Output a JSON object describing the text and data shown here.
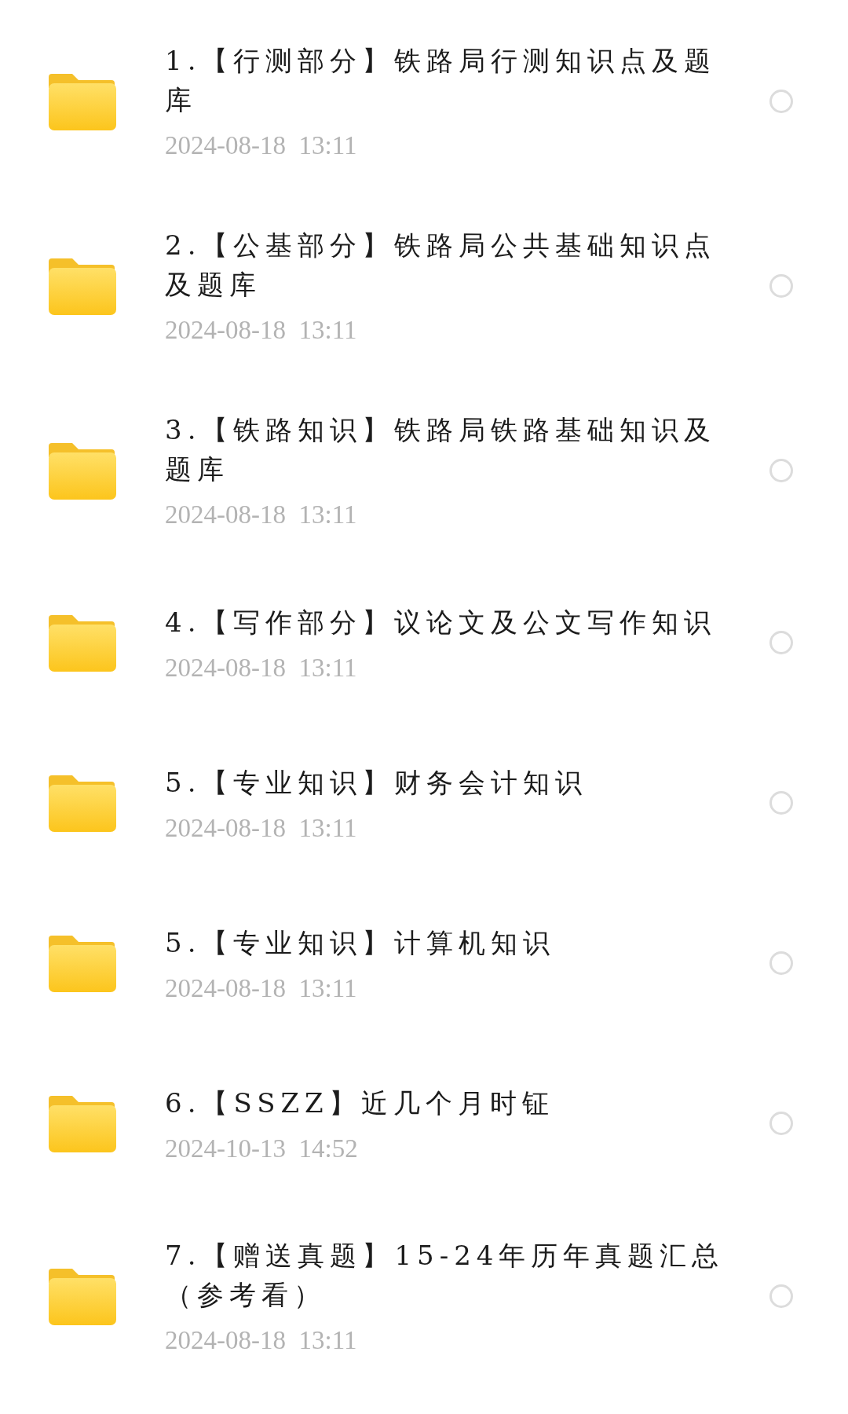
{
  "files": [
    {
      "title": "1.【行测部分】铁路局行测知识点及题库",
      "date": "2024-08-18  13:11",
      "selected": false
    },
    {
      "title": "2.【公基部分】铁路局公共基础知识点及题库",
      "date": "2024-08-18  13:11",
      "selected": false
    },
    {
      "title": "3.【铁路知识】铁路局铁路基础知识及题库",
      "date": "2024-08-18  13:11",
      "selected": false
    },
    {
      "title": "4.【写作部分】议论文及公文写作知识",
      "date": "2024-08-18  13:11",
      "selected": false
    },
    {
      "title": "5.【专业知识】财务会计知识",
      "date": "2024-08-18  13:11",
      "selected": false
    },
    {
      "title": "5.【专业知识】计算机知识",
      "date": "2024-08-18  13:11",
      "selected": false
    },
    {
      "title": "6.【SSZZ】近几个月时钲",
      "date": "2024-10-13  14:52",
      "selected": false
    },
    {
      "title": "7.【赠送真题】15-24年历年真题汇总（参考看）",
      "date": "2024-08-18  13:11",
      "selected": false
    }
  ]
}
